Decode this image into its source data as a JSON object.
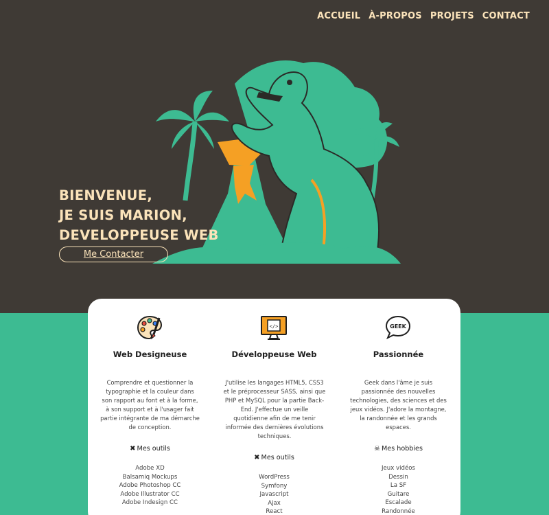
{
  "nav": {
    "items": [
      "ACCUEIL",
      "À-PROPOS",
      "PROJETS",
      "CONTACT"
    ]
  },
  "hero": {
    "lines": [
      "BIENVENUE,",
      "JE SUIS MARION,",
      "DEVELOPPEUSE WEB"
    ],
    "button": "Me Contacter"
  },
  "colors": {
    "dark": "#3f3a35",
    "cream": "#fbe3ba",
    "green": "#3dbb92",
    "orange": "#f5a024"
  },
  "columns": [
    {
      "icon": "palette-icon",
      "title": "Web Designeuse",
      "description": "Comprendre et questionner la typographie et la couleur dans son rapport au font et à la forme, à son support et à l'usager fait partie intégrante de ma démarche de conception.",
      "list_title": "Mes outils",
      "list_icon": "tools-icon",
      "items": [
        "Adobe XD",
        "Balsamiq Mockups",
        "Adobe Photoshop CC",
        "Adobe Illustrator CC",
        "Adobe Indesign CC"
      ]
    },
    {
      "icon": "code-monitor-icon",
      "icon_label": "</>",
      "title": "Développeuse Web",
      "description": "J'utilise les langages HTML5, CSS3 et le préprocesseur SASS, ainsi que PHP et MySQL pour la partie Back-End. J'effectue un veille quotidienne afin de me tenir informée des dernières évolutions techniques.",
      "list_title": "Mes outils",
      "list_icon": "tools-icon",
      "items": [
        "WordPress",
        "Symfony",
        "Javascript",
        "Ajax",
        "React"
      ]
    },
    {
      "icon": "geek-bubble-icon",
      "icon_label": "GEEK",
      "title": "Passionnée",
      "description": "Geek dans l'âme je suis passionnée des nouvelles technologies, des sciences et des jeux vidéos. J'adore la montagne, la randonnée et les grands espaces.",
      "list_title": "Mes hobbies",
      "list_icon": "skull-icon",
      "items": [
        "Jeux vidéos",
        "Dessin",
        "La SF",
        "Guitare",
        "Escalade",
        "Randonnée"
      ]
    }
  ]
}
